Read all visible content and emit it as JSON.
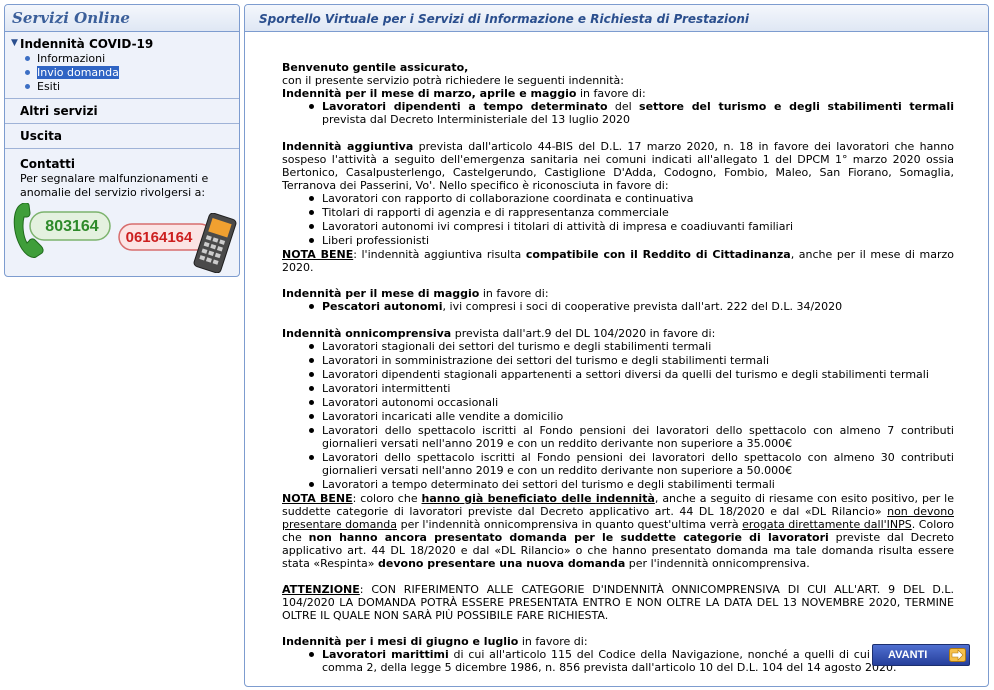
{
  "sidebar": {
    "header": "Servizi Online",
    "sections": [
      {
        "label": "Indennità COVID-19",
        "open": true,
        "items": [
          {
            "label": "Informazioni",
            "selected": false
          },
          {
            "label": "Invio domanda",
            "selected": true
          },
          {
            "label": "Esiti",
            "selected": false
          }
        ]
      },
      {
        "label": "Altri servizi"
      },
      {
        "label": "Uscita"
      }
    ],
    "contact": {
      "title": "Contatti",
      "text": "Per segnalare malfunzionamenti e anomalie del servizio rivolgersi a:",
      "phone_green": "803164",
      "phone_red": "06164164"
    }
  },
  "main": {
    "header": "Sportello Virtuale per i Servizi di Informazione e Richiesta di Prestazioni",
    "intro1": "Benvenuto gentile assicurato,",
    "intro2": "con il presente servizio potrà richiedere le seguenti indennità:",
    "s1": {
      "title": "Indennità per il mese di marzo, aprile e maggio",
      "after": " in favore di:",
      "item_b1": "Lavoratori dipendenti a tempo determinato",
      "item_t1": " del ",
      "item_b2": "settore del turismo e degli stabilimenti termali",
      "item_t2": " prevista dal Decreto Interministeriale del 13 luglio 2020"
    },
    "s2": {
      "title": "Indennità aggiuntiva",
      "text": " prevista dall'articolo 44-BIS del D.L. 17 marzo 2020, n. 18 in favore dei lavoratori che hanno sospeso l'attività a seguito dell'emergenza sanitaria nei comuni indicati all'allegato 1 del DPCM 1° marzo 2020 ossia Bertonico, Casalpusterlengo, Castelgerundo, Castiglione D'Adda, Codogno, Fombio, Maleo, San Fiorano, Somaglia, Terranova dei Passerini, Vo'. Nello specifico è riconosciuta in favore di:",
      "items": [
        "Lavoratori con rapporto di collaborazione coordinata e continuativa",
        "Titolari di rapporti di agenzia e di rappresentanza commerciale",
        "Lavoratori autonomi ivi compresi i titolari di attività di impresa e coadiuvanti familiari",
        "Liberi professionisti"
      ],
      "nb_label": "NOTA BENE",
      "nb_t1": ": l'indennità aggiuntiva risulta ",
      "nb_b": "compatibile con il Reddito di Cittadinanza",
      "nb_t2": ", anche per il mese di marzo 2020."
    },
    "s3": {
      "title": "Indennità per il mese di maggio",
      "after": " in favore di:",
      "item_b": "Pescatori autonomi",
      "item_t": ", ivi compresi i soci di cooperative prevista dall'art. 222 del D.L. 34/2020"
    },
    "s4": {
      "title": "Indennità onnicomprensiva",
      "after": " prevista dall'art.9 del DL 104/2020 in favore di:",
      "items": [
        "Lavoratori stagionali dei settori del turismo e degli stabilimenti termali",
        "Lavoratori in somministrazione dei settori del turismo e degli stabilimenti termali",
        "Lavoratori dipendenti stagionali appartenenti a settori diversi da quelli del turismo e degli stabilimenti termali",
        "Lavoratori intermittenti",
        "Lavoratori autonomi occasionali",
        "Lavoratori incaricati alle vendite a domicilio",
        "Lavoratori dello spettacolo iscritti al Fondo pensioni dei lavoratori dello spettacolo con almeno 7 contributi giornalieri versati nell'anno 2019 e con un reddito derivante non superiore a 35.000€",
        "Lavoratori dello spettacolo iscritti al Fondo pensioni dei lavoratori dello spettacolo con almeno 30 contributi giornalieri versati nell'anno 2019 e con un reddito derivante non superiore a 50.000€",
        "Lavoratori a tempo determinato dei settori del turismo e degli stabilimenti termali"
      ],
      "nb_label": "NOTA BENE",
      "nb_t1": ": coloro che ",
      "nb_u1": "hanno già beneficiato delle indennità",
      "nb_t2": ", anche a seguito di riesame con esito positivo, per le suddette categorie di lavoratori previste dal Decreto applicativo art. 44 DL 18/2020 e dal «DL Rilancio» ",
      "nb_u2": "non devono presentare domanda",
      "nb_t3": " per l'indennità onnicomprensiva in quanto quest'ultima verrà ",
      "nb_u3": "erogata direttamente dall'INPS",
      "nb_t4": ". Coloro che ",
      "nb_b1": "non hanno ancora presentato domanda per le suddette categorie di lavoratori",
      "nb_t5": " previste dal Decreto applicativo art. 44 DL 18/2020 e dal «DL Rilancio» o che hanno presentato domanda ma tale domanda risulta essere stata «Respinta» ",
      "nb_b2": "devono presentare una nuova domanda",
      "nb_t6": " per l'indennità onnicomprensiva."
    },
    "attention": {
      "label": "ATTENZIONE",
      "text": ": CON RIFERIMENTO ALLE CATEGORIE D'INDENNITÀ ONNICOMPRENSIVA DI CUI ALL'ART. 9 DEL D.L. 104/2020 LA DOMANDA POTRÀ ESSERE PRESENTATA ENTRO E NON OLTRE LA DATA DEL 13 NOVEMBRE 2020, TERMINE OLTRE IL QUALE NON SARÀ PIÙ POSSIBILE FARE RICHIESTA."
    },
    "s5": {
      "title": "Indennità per i mesi di giugno e luglio",
      "after": " in favore di:",
      "item_b": "Lavoratori marittimi",
      "item_t": " di cui all'articolo 115 del Codice della Navigazione, nonché a quelli di cui all'articolo 17, comma 2, della legge 5 dicembre 1986, n. 856 prevista dall'articolo 10 del D.L. 104 del 14 agosto 2020."
    },
    "button_label": "AVANTI"
  },
  "colors": {
    "panel_border": "#7d9ccf",
    "header_text": "#2b4f8e",
    "selected_bg": "#2f64c4",
    "button_bg": "#263f9b",
    "button_arrow": "#f5a623"
  }
}
